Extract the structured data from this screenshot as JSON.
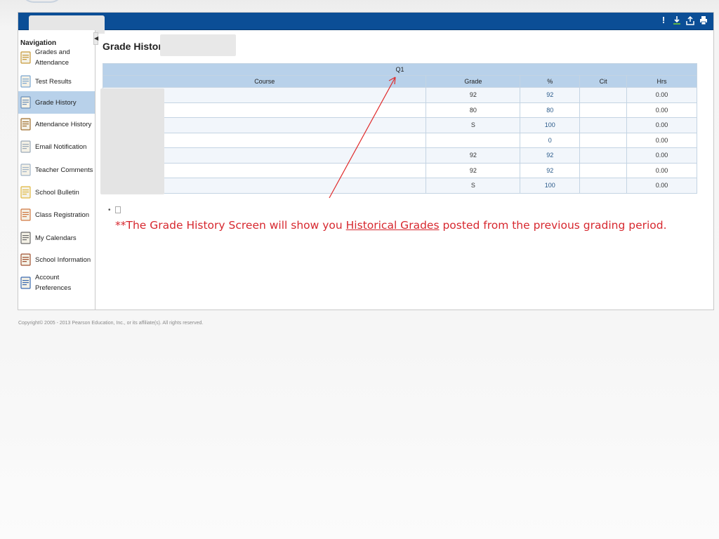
{
  "toolbar": {
    "icons": [
      "alert-icon",
      "download-icon",
      "export-icon",
      "print-icon"
    ],
    "alert_glyph": "!"
  },
  "sidebar": {
    "title": "Navigation",
    "items": [
      {
        "label": "Grades and Attendance",
        "icon": "grades-icon"
      },
      {
        "label": "Test Results",
        "icon": "test-results-icon"
      },
      {
        "label": "Grade History",
        "icon": "grade-history-icon",
        "active": true
      },
      {
        "label": "Attendance History",
        "icon": "clock-icon"
      },
      {
        "label": "Email Notification",
        "icon": "envelope-icon"
      },
      {
        "label": "Teacher Comments",
        "icon": "comment-icon"
      },
      {
        "label": "School Bulletin",
        "icon": "bulletin-icon"
      },
      {
        "label": "Class Registration",
        "icon": "registration-icon"
      },
      {
        "label": "My Calendars",
        "icon": "calendar-icon"
      },
      {
        "label": "School Information",
        "icon": "school-icon"
      },
      {
        "label": "Account Preferences",
        "icon": "account-icon"
      }
    ]
  },
  "main": {
    "title": "Grade History:",
    "table": {
      "term": "Q1",
      "columns": [
        "Course",
        "Grade",
        "%",
        "Cit",
        "Hrs"
      ],
      "rows": [
        {
          "course": "",
          "grade": "92",
          "pct": "92",
          "cit": "",
          "hrs": "0.00"
        },
        {
          "course": "",
          "grade": "80",
          "pct": "80",
          "cit": "",
          "hrs": "0.00"
        },
        {
          "course": "",
          "grade": "S",
          "pct": "100",
          "cit": "",
          "hrs": "0.00"
        },
        {
          "course": "",
          "grade": "",
          "pct": "0",
          "cit": "",
          "hrs": "0.00"
        },
        {
          "course": "",
          "grade": "92",
          "pct": "92",
          "cit": "",
          "hrs": "0.00"
        },
        {
          "course": "",
          "grade": "92",
          "pct": "92",
          "cit": "",
          "hrs": "0.00"
        },
        {
          "course": "",
          "grade": "S",
          "pct": "100",
          "cit": "",
          "hrs": "0.00"
        }
      ]
    },
    "bullet": "•",
    "bullet_icon": "help-icon"
  },
  "annotation": {
    "prefix": "**The Grade History Screen will show you ",
    "link": "Historical Grades",
    "suffix": " posted from the previous grading period.",
    "color": "#d7282f"
  },
  "footer": {
    "copyright": "Copyright© 2005 - 2013 Pearson Education, Inc., or its affiliate(s). All rights reserved."
  },
  "colors": {
    "top_bar": "#0b4e96",
    "header_row": "#b8d1ea",
    "active_nav": "#b8d1ea"
  }
}
